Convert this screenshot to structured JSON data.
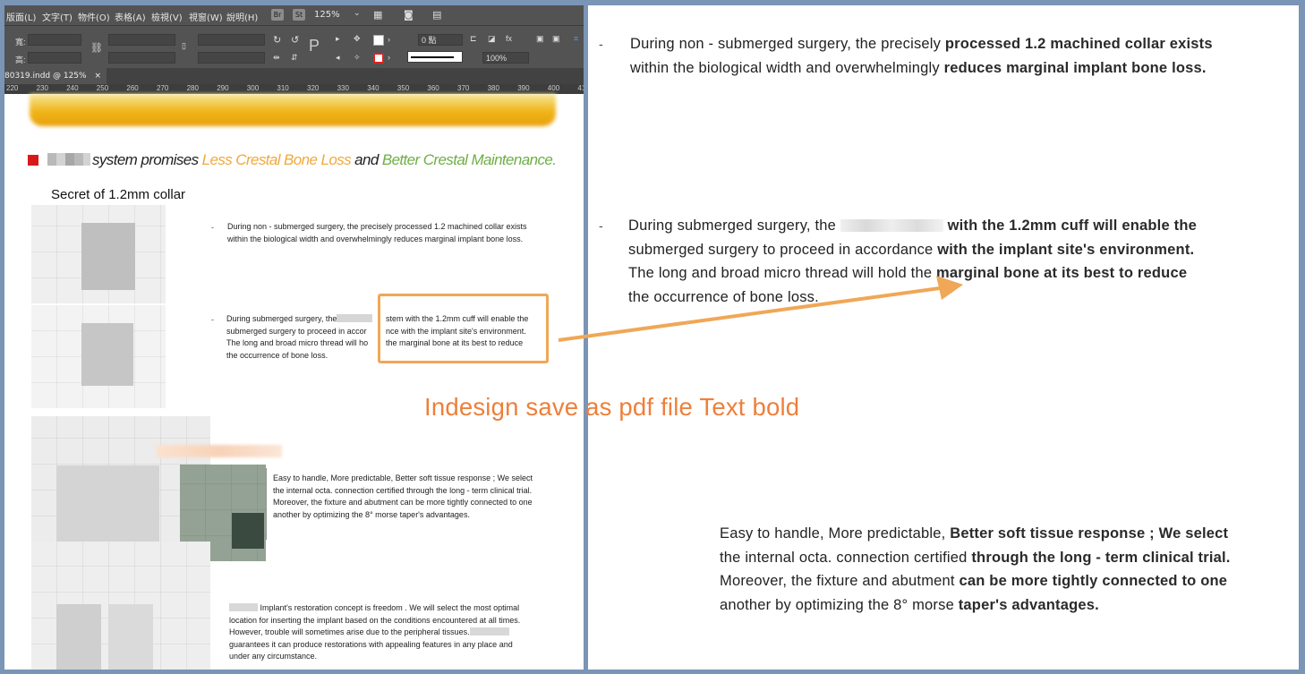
{
  "colors": {
    "frame": "#7a95b6",
    "accent_orange": "#f0a757",
    "caption_orange": "#ee7f3a",
    "headline_orange": "#f0a93c",
    "headline_green": "#6fae46",
    "bullet_red": "#d8191b"
  },
  "app": {
    "menu": [
      "版面(L)",
      "文字(T)",
      "物件(O)",
      "表格(A)",
      "檢視(V)",
      "視窗(W)",
      "說明(H)"
    ],
    "badges": [
      "Br",
      "St"
    ],
    "zoom": "125%",
    "tab_title": "80319.indd @ 125%",
    "tab_close": "×",
    "toolbar": {
      "width_label": "寬:",
      "height_label": "高:",
      "stroke_weight": "0 點",
      "opacity": "100%"
    },
    "ruler_ticks": [
      "220",
      "230",
      "240",
      "250",
      "260",
      "270",
      "280",
      "290",
      "300",
      "310",
      "320",
      "330",
      "340",
      "350",
      "360",
      "370",
      "380",
      "390",
      "400",
      "41"
    ]
  },
  "document": {
    "headline": {
      "part1": "system promises",
      "part2": "Less Crestal Bone Loss",
      "part3": "and",
      "part4": "Better Crestal Maintenance."
    },
    "section_title": "Secret of 1.2mm collar",
    "bullet": "-",
    "para1": [
      "During non - submerged surgery, the precisely processed 1.2 machined collar exists",
      "within the biological width and overwhelmingly reduces marginal implant bone loss."
    ],
    "para2": [
      "During submerged surgery, the",
      "stem with the 1.2mm cuff will enable the",
      "submerged surgery to proceed in accor",
      "nce with the implant site's environment.",
      "The long and broad micro thread will ho",
      "the marginal bone at its best to reduce",
      "the occurrence of bone loss."
    ],
    "para3": [
      "Easy to handle, More predictable, Better soft tissue response ; We select",
      "the internal octa. connection certified through the long - term clinical trial.",
      "Moreover, the fixture and abutment can be more tightly connected to one",
      "another by optimizing the 8° morse taper's advantages."
    ],
    "para4": [
      "Implant's restoration concept is freedom . We will select the most optimal",
      "location for inserting the implant based on the conditions encountered at all times.",
      "However, trouble will sometimes arise due to the peripheral tissues.",
      "guarantees it can produce restorations with appealing features in any place and",
      "under any circumstance."
    ]
  },
  "pdf": {
    "bullet": "-",
    "p1_a": "During non - submerged surgery, the precisely ",
    "p1_b": "processed 1.2 machined collar exists",
    "p1_c": "within the biological width and overwhelmingly ",
    "p1_d": "reduces marginal implant bone loss.",
    "p2_a": "During submerged surgery, the ",
    "p2_b": " with the 1.2mm cuff will enable the",
    "p2_c": "submerged surgery to proceed in accordance ",
    "p2_d": "with the implant site's environment.",
    "p2_e": "The long and broad micro thread will hold the ",
    "p2_f": "marginal bone at its best to reduce",
    "p2_g": "the occurrence of bone loss.",
    "p3_a": "Easy to handle, More predictable, ",
    "p3_b": "Better soft tissue response ; We select",
    "p3_c": "the internal octa. connection certified ",
    "p3_d": "through the long - term clinical trial.",
    "p3_e": "Moreover, the fixture and abutment ",
    "p3_f": "can be more tightly connected to one",
    "p3_g": "another by optimizing the 8° morse ",
    "p3_h": "taper's advantages."
  },
  "caption": "Indesign save as pdf file Text bold"
}
